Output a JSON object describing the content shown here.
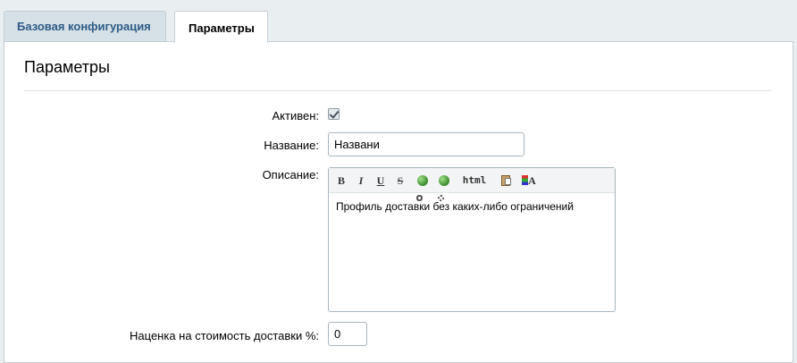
{
  "tabs": [
    {
      "label": "Базовая конфигурация",
      "active": false
    },
    {
      "label": "Параметры",
      "active": true
    }
  ],
  "section": {
    "title": "Параметры"
  },
  "form": {
    "active": {
      "label": "Активен:",
      "checked": true
    },
    "name": {
      "label": "Название:",
      "value": "Названи"
    },
    "description": {
      "label": "Описание:",
      "toolbar": {
        "bold": "B",
        "italic": "I",
        "underline": "U",
        "strike": "S",
        "html": "html",
        "font": "A",
        "icons": [
          "bold-icon",
          "italic-icon",
          "underline-icon",
          "strikethrough-icon",
          "insert-link-icon",
          "remove-link-icon",
          "html-mode-icon",
          "paste-icon",
          "font-color-icon"
        ]
      },
      "value": "Профиль доставки без каких-либо ограничений"
    },
    "markup": {
      "label": "Наценка на стоимость доставки %:",
      "value": "0"
    }
  },
  "colors": {
    "tab_inactive_text": "#2d5b86",
    "background": "#e9eef1",
    "panel": "#ffffff"
  }
}
